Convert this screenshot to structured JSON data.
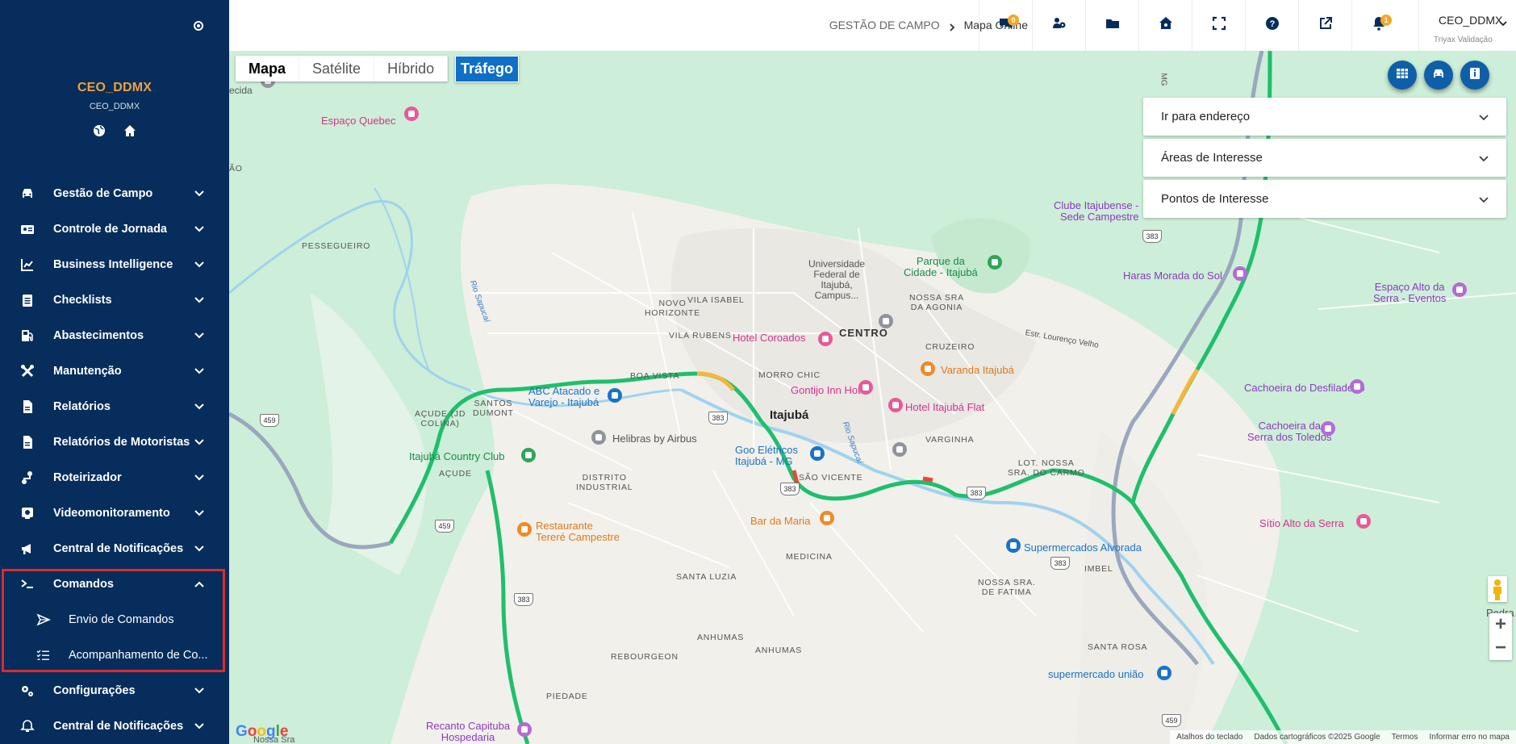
{
  "sidebar": {
    "user_name": "CEO_DDMX",
    "user_sub": "CEO_DDMX",
    "items": [
      {
        "label": "Gestão de Campo",
        "icon": "car-icon",
        "chevron": "down"
      },
      {
        "label": "Controle de Jornada",
        "icon": "id-card-icon",
        "chevron": "down"
      },
      {
        "label": "Business Intelligence",
        "icon": "line-chart-icon",
        "chevron": "down"
      },
      {
        "label": "Checklists",
        "icon": "clipboard-icon",
        "chevron": "down"
      },
      {
        "label": "Abastecimentos",
        "icon": "fuel-pump-icon",
        "chevron": "down"
      },
      {
        "label": "Manutenção",
        "icon": "tools-icon",
        "chevron": "down"
      },
      {
        "label": "Relatórios",
        "icon": "document-icon",
        "chevron": "down"
      },
      {
        "label": "Relatórios de Motoristas",
        "icon": "document-icon",
        "chevron": "down"
      },
      {
        "label": "Roteirizador",
        "icon": "route-icon",
        "chevron": "down"
      },
      {
        "label": "Videomonitoramento",
        "icon": "video-icon",
        "chevron": "down"
      },
      {
        "label": "Central de Notificações",
        "icon": "bullhorn-icon",
        "chevron": "down"
      },
      {
        "label": "Comandos",
        "icon": "terminal-icon",
        "chevron": "up"
      },
      {
        "label": "Envio de Comandos",
        "icon": "send-icon",
        "sub": true
      },
      {
        "label": "Acompanhamento de Co...",
        "icon": "list-check-icon",
        "sub": true
      },
      {
        "label": "Configurações",
        "icon": "gears-icon",
        "chevron": "down"
      },
      {
        "label": "Central de Notificações",
        "icon": "bell-gear-icon",
        "chevron": "down"
      }
    ]
  },
  "topbar": {
    "breadcrumb_parent": "GESTÃO DE CAMPO",
    "breadcrumb_current": "Mapa Online",
    "icons": [
      {
        "name": "chat-icon",
        "badge": "0"
      },
      {
        "name": "users-gear-icon"
      },
      {
        "name": "folder-icon"
      },
      {
        "name": "home-gear-icon"
      },
      {
        "name": "fullscreen-icon"
      },
      {
        "name": "help-icon"
      },
      {
        "name": "external-link-icon"
      },
      {
        "name": "bell-icon",
        "badge": "1"
      }
    ],
    "user_name": "CEO_DDMX",
    "user_company": "Triyax Validação"
  },
  "map": {
    "types": [
      "Mapa",
      "Satélite",
      "Híbrido"
    ],
    "selected_type": "Mapa",
    "traffic_label": "Tráfego",
    "accordion": [
      "Ir para endereço",
      "Áreas de Interesse",
      "Pontos de Interesse"
    ],
    "labels": {
      "espaco_quebec": "Espaço Quebec",
      "pesseguiero": "PESSEGUEIRO",
      "ao": "ÃO",
      "cida": "ecida",
      "universidade": "Universidade\nFederal de\nItajubá,\nCampus...",
      "parque": "Parque da\nCidade - Itajubá",
      "nossa_agonia": "NOSSA SRA\nDA AGONIA",
      "novo_horizonte": "NOVO\nHORIZONTE",
      "vila_isabel": "VILA ISABEL",
      "vila_rubens": "VILA RUBENS",
      "hotel_coroados": "Hotel Coroados",
      "centro": "CENTRO",
      "cruzeiro": "CRUZEIRO",
      "boa_vista": "BOA VISTA",
      "morro_chic": "MORRO CHIC",
      "gontijo": "Gontijo Inn Hotel",
      "varanda": "Varanda Itajubá",
      "hotel_flat": "Hotel Itajubá Flat",
      "abc": "ABC Atacado e\nVarejo - Itajubá",
      "santos_dumont": "SANTOS\nDUMONT",
      "acude_jd": "AÇUDE (JD\nCOLINA)",
      "itajuba": "Itajubá",
      "varginha": "VARGINHA",
      "helibras": "Helibras by Airbus",
      "goo": "Goo Elétricos\nItajubá - MG",
      "sao_vicente": "SÃO VICENTE",
      "country": "Itajubá Country Club",
      "acude": "AÇUDE",
      "distrito": "DISTRITO\nINDUSTRIAL",
      "bar_maria": "Bar da Maria",
      "restaurante": "Restaurante\nTereré Campestre",
      "medicina": "MEDICINA",
      "santa_luzia": "SANTA LUZIA",
      "clube": "Clube Itajubense -\nSede Campestre",
      "haras": "Haras Morada do Sol",
      "espaco_alto": "Espaço Alto da\nSerra - Eventos",
      "estr_lorenco": "Estr. Lourenço Velho",
      "cachoeira_desf": "Cachoeira do Desfiladeiro",
      "cachoeira_serra": "Cachoeira da\nSerra dos Toledos",
      "lot_nossa": "LOT. NOSSA\nSRA. DO CARMO",
      "supermercados": "Supermercados Alvorada",
      "imbel": "IMBEL",
      "sitio": "Sítio Alto da Serra",
      "nossa_fatima": "NOSSA SRA.\nDE FATIMA",
      "pedra_amar": "Pedra Amar",
      "anhumas1": "ANHUMAS",
      "anhumas2": "ANHUMAS",
      "rebourgeon": "REBOURGEON",
      "santa_rosa": "SANTA ROSA",
      "supermercado_uniao": "supermercado união",
      "piedade": "PIEDADE",
      "recanto": "Recanto Capituba\nHospedaria",
      "nossa_sra_bottom": "Nossa Sra",
      "rio_sapucai": "Rio Sapucaí",
      "rio_sapucai2": "Rio Sapucaí",
      "mg": "MG"
    },
    "shields": [
      "383",
      "459",
      "383",
      "383",
      "383",
      "383",
      "459",
      "383",
      "383",
      "459"
    ],
    "google_logo": "Google",
    "attribution": [
      "Atalhos do teclado",
      "Dados cartográficos ©2025 Google",
      "Termos",
      "Informar erro no mapa"
    ]
  },
  "colors": {
    "sidebar_bg": "#062d5c",
    "accent_orange": "#f0a23a",
    "traffic_blue": "#0f6fc6",
    "highlight_red": "#e02a2a",
    "fab_blue": "#0f5fa8"
  }
}
